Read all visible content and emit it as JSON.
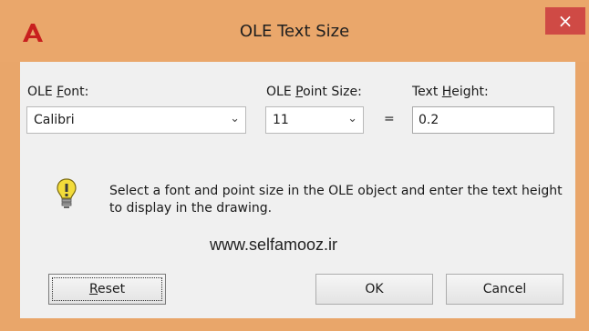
{
  "window": {
    "title": "OLE Text Size",
    "close_glyph": "×",
    "icon": "autocad-logo-icon"
  },
  "fields": {
    "font_label_pre": "OLE ",
    "font_label_accel": "F",
    "font_label_post": "ont:",
    "font_value": "Calibri",
    "point_label_pre": "OLE ",
    "point_label_accel": "P",
    "point_label_post": "oint Size:",
    "point_value": "11",
    "equals": "=",
    "height_label_pre": "Text ",
    "height_label_accel": "H",
    "height_label_post": "eight:",
    "height_value": "0.2"
  },
  "info": {
    "icon": "lightbulb-icon",
    "text": "Select a font and point size in the OLE object and enter the text height to display in the drawing."
  },
  "watermark": "www.selfamooz.ir",
  "buttons": {
    "reset_accel": "R",
    "reset_rest": "eset",
    "ok": "OK",
    "cancel": "Cancel"
  },
  "colors": {
    "frame": "#eaa76b",
    "client": "#f0f0f0",
    "close": "#cf4a45"
  }
}
